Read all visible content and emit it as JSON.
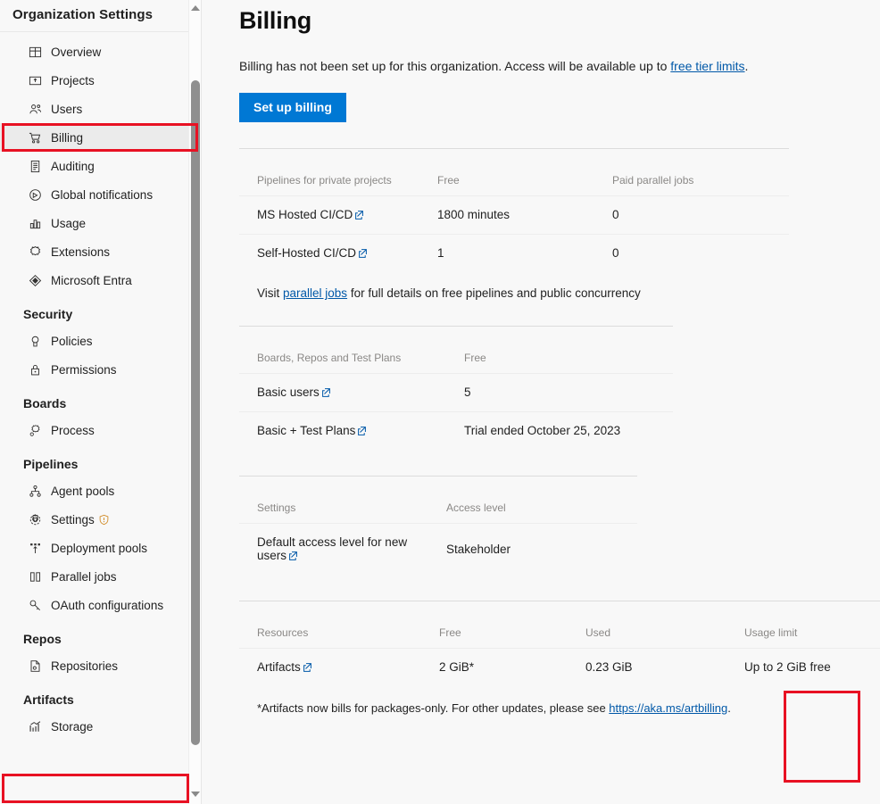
{
  "sidebar": {
    "title": "Organization Settings",
    "items": [
      {
        "type": "item",
        "label": "Overview",
        "icon": "grid-icon",
        "selected": false
      },
      {
        "type": "item",
        "label": "Projects",
        "icon": "project-icon",
        "selected": false
      },
      {
        "type": "item",
        "label": "Users",
        "icon": "people-icon",
        "selected": false
      },
      {
        "type": "item",
        "label": "Billing",
        "icon": "shopping-cart-icon",
        "selected": true
      },
      {
        "type": "item",
        "label": "Auditing",
        "icon": "audit-log-icon",
        "selected": false
      },
      {
        "type": "item",
        "label": "Global notifications",
        "icon": "notification-icon",
        "selected": false
      },
      {
        "type": "item",
        "label": "Usage",
        "icon": "bar-chart-icon",
        "selected": false
      },
      {
        "type": "item",
        "label": "Extensions",
        "icon": "extensions-icon",
        "selected": false
      },
      {
        "type": "item",
        "label": "Microsoft Entra",
        "icon": "entra-icon",
        "selected": false
      },
      {
        "type": "group",
        "label": "Security"
      },
      {
        "type": "item",
        "label": "Policies",
        "icon": "policy-icon",
        "selected": false
      },
      {
        "type": "item",
        "label": "Permissions",
        "icon": "lock-icon",
        "selected": false
      },
      {
        "type": "group",
        "label": "Boards"
      },
      {
        "type": "item",
        "label": "Process",
        "icon": "process-icon",
        "selected": false
      },
      {
        "type": "group",
        "label": "Pipelines"
      },
      {
        "type": "item",
        "label": "Agent pools",
        "icon": "agent-pools-icon",
        "selected": false
      },
      {
        "type": "item",
        "label": "Settings",
        "icon": "gear-icon",
        "selected": false,
        "badge": "warning-shield-icon"
      },
      {
        "type": "item",
        "label": "Deployment pools",
        "icon": "deployment-pools-icon",
        "selected": false
      },
      {
        "type": "item",
        "label": "Parallel jobs",
        "icon": "parallel-jobs-icon",
        "selected": false
      },
      {
        "type": "item",
        "label": "OAuth configurations",
        "icon": "key-icon",
        "selected": false
      },
      {
        "type": "group",
        "label": "Repos"
      },
      {
        "type": "item",
        "label": "Repositories",
        "icon": "repository-icon",
        "selected": false
      },
      {
        "type": "group",
        "label": "Artifacts"
      },
      {
        "type": "item",
        "label": "Storage",
        "icon": "storage-chart-icon",
        "selected": false
      }
    ]
  },
  "main": {
    "page_title": "Billing",
    "intro_before_link": "Billing has not been set up for this organization. Access will be available up to ",
    "intro_link": "free tier limits",
    "intro_after_link": ".",
    "setup_button": "Set up billing",
    "tables": [
      {
        "name": "pipelines-table",
        "headers": [
          "Pipelines for private projects",
          "Free",
          "Paid parallel jobs"
        ],
        "rows": [
          [
            "MS Hosted CI/CD",
            "1800 minutes",
            "0"
          ],
          [
            "Self-Hosted CI/CD",
            "1",
            "0"
          ]
        ],
        "note_before_link": "Visit ",
        "note_link": "parallel jobs",
        "note_after_link": " for full details on free pipelines and public concurrency"
      },
      {
        "name": "boards-repos-testplans-table",
        "headers": [
          "Boards, Repos and Test Plans",
          "Free"
        ],
        "rows": [
          [
            "Basic users",
            "5"
          ],
          [
            "Basic + Test Plans",
            "Trial ended October 25, 2023"
          ]
        ]
      },
      {
        "name": "settings-table",
        "headers": [
          "Settings",
          "Access level"
        ],
        "rows": [
          [
            "Default access level for new users",
            "Stakeholder"
          ]
        ]
      },
      {
        "name": "resources-table",
        "headers": [
          "Resources",
          "Free",
          "Used",
          "Usage limit"
        ],
        "rows": [
          [
            "Artifacts",
            "2 GiB*",
            "0.23 GiB",
            "Up to 2 GiB free"
          ]
        ],
        "footnote_before_link": "*Artifacts now bills for packages-only. For other updates, please see ",
        "footnote_link": "https://aka.ms/artbilling",
        "footnote_after_link": "."
      }
    ]
  },
  "annotations": {
    "highlight_color": "#e81123",
    "boxes": [
      "billing-nav-item",
      "storage-nav-item",
      "used-column"
    ]
  },
  "colors": {
    "accent": "#0078d4",
    "link": "#0058a8",
    "highlight": "#e81123",
    "page_background": "#f8f8f8",
    "selected_nav": "#ebebeb"
  }
}
